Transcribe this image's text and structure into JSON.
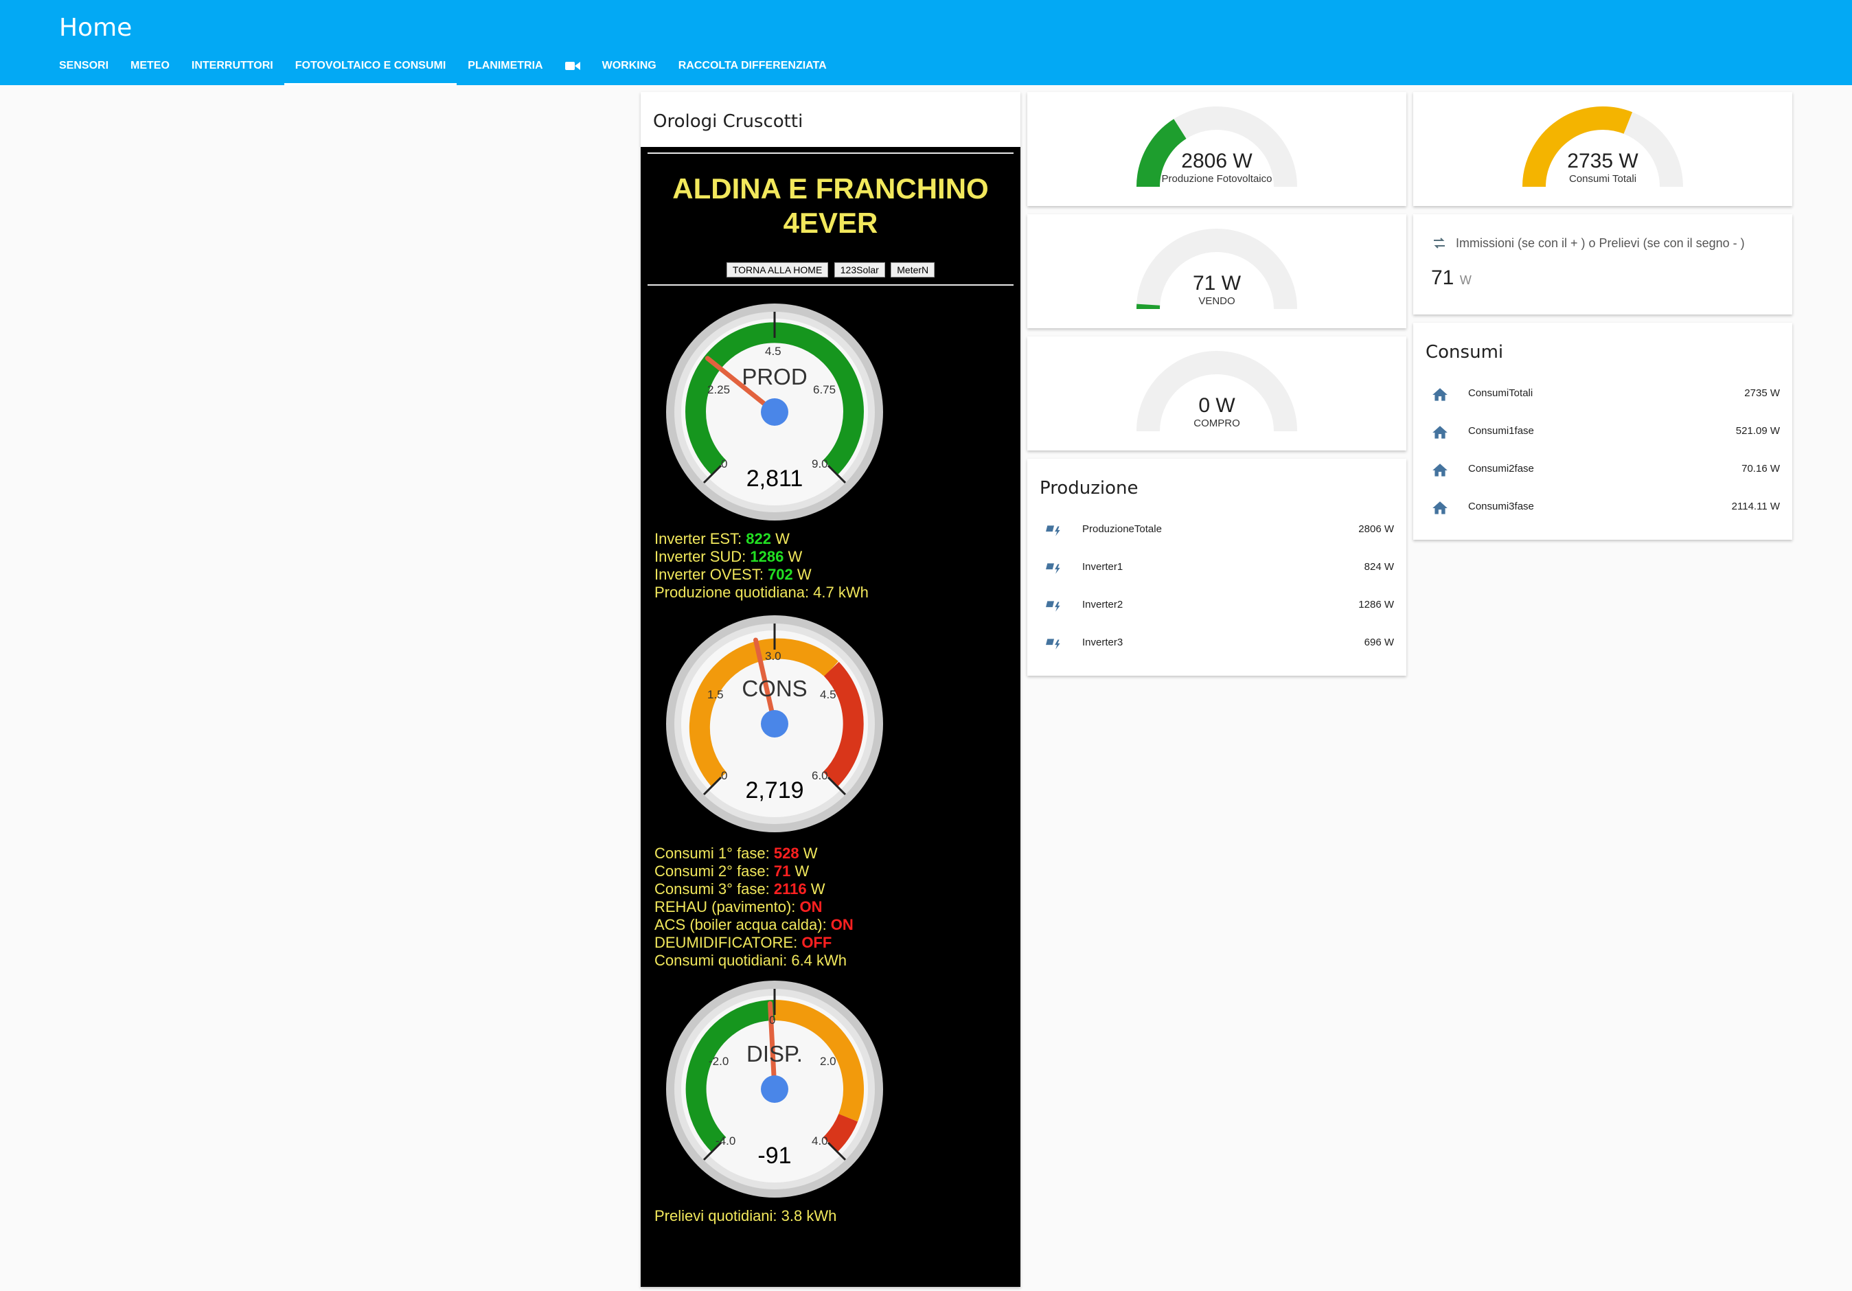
{
  "header": {
    "title": "Home",
    "tabs": [
      "SENSORI",
      "METEO",
      "INTERRUTTORI",
      "FOTOVOLTAICO E CONSUMI",
      "PLANIMETRIA",
      "WORKING",
      "RACCOLTA DIFFERENZIATA"
    ],
    "camera_tab_icon": "video-camera-icon"
  },
  "dashboard": {
    "title": "Orologi Cruscotti",
    "banner_line1": "ALDINA E FRANCHINO",
    "banner_line2": "4EVER",
    "buttons": [
      "TORNA ALLA HOME",
      "123Solar",
      "MeterN"
    ],
    "prod": {
      "name": "PROD",
      "value": "2,811",
      "ticks": [
        "0",
        "2.25",
        "4.5",
        "6.75",
        "9.0"
      ],
      "level": 0.31
    },
    "prod_info": {
      "l1_label": "Inverter EST: ",
      "l1_value": "822",
      "l1_unit": " W",
      "l2_label": "Inverter SUD: ",
      "l2_value": "1286",
      "l2_unit": " W",
      "l3_label": "Inverter OVEST: ",
      "l3_value": "702",
      "l3_unit": " W",
      "l4": "Produzione quotidiana: 4.7 kWh"
    },
    "cons": {
      "name": "CONS",
      "value": "2,719",
      "ticks": [
        "0",
        "1.5",
        "3.0",
        "4.5",
        "6.0"
      ],
      "level": 0.453
    },
    "cons_info": {
      "l1_label": "Consumi 1° fase: ",
      "l1_value": "528",
      "l1_unit": " W",
      "l2_label": "Consumi 2° fase: ",
      "l2_value": "71",
      "l2_unit": " W",
      "l3_label": "Consumi 3° fase: ",
      "l3_value": "2116",
      "l3_unit": " W",
      "l4_label": "REHAU (pavimento): ",
      "l4_value": "ON",
      "l5_label": "ACS (boiler acqua calda): ",
      "l5_value": "ON",
      "l6_label": "DEUMIDIFICATORE: ",
      "l6_value": "OFF",
      "l7": "Consumi quotidiani: 6.4 kWh"
    },
    "disp": {
      "name": "DISP.",
      "value": "-91",
      "ticks": [
        "-4.0",
        "-2.0",
        "0",
        "2.0",
        "4.0"
      ],
      "level": 0.489
    },
    "disp_info": "Prelievi quotidiani: 3.8 kWh"
  },
  "gauges": {
    "fotovoltaico": {
      "value": "2806 W",
      "label": "Produzione Fotovoltaico",
      "level": 0.32,
      "color": "#1e9e2e"
    },
    "vendo": {
      "value": "71 W",
      "label": "VENDO",
      "level": 0.02,
      "color": "#1e9e2e"
    },
    "compro": {
      "value": "0 W",
      "label": "COMPRO",
      "level": 0.0,
      "color": "#1e9e2e"
    },
    "consumi_totali": {
      "value": "2735 W",
      "label": "Consumi Totali",
      "level": 0.62,
      "color": "#f4b400"
    }
  },
  "immissioni": {
    "label": "Immissioni (se con il + ) o Prelievi (se con il segno - )",
    "value": "71",
    "unit": "W",
    "icon": "swap-arrows-icon"
  },
  "produzione": {
    "title": "Produzione",
    "icon": "solar-power-icon",
    "rows": [
      {
        "name": "ProduzioneTotale",
        "value": "2806 W"
      },
      {
        "name": "Inverter1",
        "value": "824 W"
      },
      {
        "name": "Inverter2",
        "value": "1286 W"
      },
      {
        "name": "Inverter3",
        "value": "696 W"
      }
    ]
  },
  "consumi": {
    "title": "Consumi",
    "icon": "home-icon",
    "rows": [
      {
        "name": "ConsumiTotali",
        "value": "2735 W"
      },
      {
        "name": "Consumi1fase",
        "value": "521.09 W"
      },
      {
        "name": "Consumi2fase",
        "value": "70.16 W"
      },
      {
        "name": "Consumi3fase",
        "value": "2114.11 W"
      }
    ]
  }
}
